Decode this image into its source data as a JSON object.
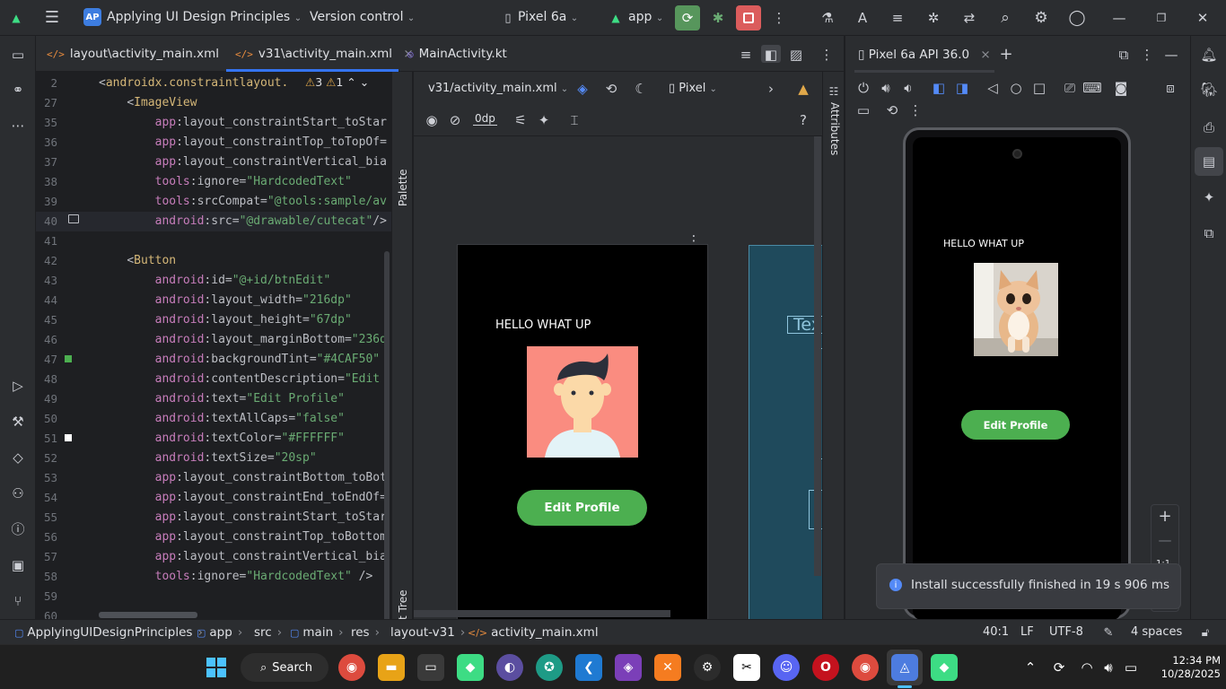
{
  "titlebar": {
    "project_badge": "AP",
    "project_name": "Applying UI Design Principles",
    "vcs": "Version control",
    "device": "Pixel 6a",
    "run_config": "app"
  },
  "tabs": [
    {
      "label": "layout\\activity_main.xml"
    },
    {
      "label": "v31\\activity_main.xml"
    },
    {
      "label": "MainActivity.kt"
    }
  ],
  "editor": {
    "inspection": {
      "warnings": "3",
      "weak": "1"
    },
    "lines": [
      {
        "num": "2",
        "html": "<span class=\"p\">&lt;</span><span class=\"t\">androidx.constraintlayout.</span>"
      },
      {
        "num": "27",
        "html": "    <span class=\"p\">&lt;</span><span class=\"t\">ImageView</span>"
      },
      {
        "num": "35",
        "html": "        <span class=\"a\">app</span><span class=\"n\">:layout_constraintStart_toStar</span>"
      },
      {
        "num": "36",
        "html": "        <span class=\"a\">app</span><span class=\"n\">:layout_constraintTop_toTopOf=</span>"
      },
      {
        "num": "37",
        "html": "        <span class=\"a\">app</span><span class=\"n\">:layout_constraintVertical_bia</span>"
      },
      {
        "num": "38",
        "html": "        <span class=\"a\">tools</span><span class=\"n\">:ignore=</span><span class=\"s\">\"HardcodedText\"</span>"
      },
      {
        "num": "39",
        "html": "        <span class=\"a\">tools</span><span class=\"n\">:srcCompat=</span><span class=\"s\">\"@tools:sample/av</span>"
      },
      {
        "num": "40",
        "html": "        <span class=\"a\">android</span><span class=\"n\">:src=</span><span class=\"s\">\"@drawable/cutecat\"</span><span class=\"p\">/&gt;</span>"
      },
      {
        "num": "41",
        "html": ""
      },
      {
        "num": "42",
        "html": "    <span class=\"p\">&lt;</span><span class=\"t\">Button</span>"
      },
      {
        "num": "43",
        "html": "        <span class=\"a\">android</span><span class=\"n\">:id=</span><span class=\"s\">\"@+id/btnEdit\"</span>"
      },
      {
        "num": "44",
        "html": "        <span class=\"a\">android</span><span class=\"n\">:layout_width=</span><span class=\"s\">\"216dp\"</span>"
      },
      {
        "num": "45",
        "html": "        <span class=\"a\">android</span><span class=\"n\">:layout_height=</span><span class=\"s\">\"67dp\"</span>"
      },
      {
        "num": "46",
        "html": "        <span class=\"a\">android</span><span class=\"n\">:layout_marginBottom=</span><span class=\"s\">\"236d</span>"
      },
      {
        "num": "47",
        "html": "        <span class=\"a\">android</span><span class=\"n\">:backgroundTint=</span><span class=\"s\">\"#4CAF50\"</span>"
      },
      {
        "num": "48",
        "html": "        <span class=\"a\">android</span><span class=\"n\">:contentDescription=</span><span class=\"s\">\"Edit</span>"
      },
      {
        "num": "49",
        "html": "        <span class=\"a\">android</span><span class=\"n\">:text=</span><span class=\"s\">\"Edit Profile\"</span>"
      },
      {
        "num": "50",
        "html": "        <span class=\"a\">android</span><span class=\"n\">:textAllCaps=</span><span class=\"s\">\"false\"</span>"
      },
      {
        "num": "51",
        "html": "        <span class=\"a\">android</span><span class=\"n\">:textColor=</span><span class=\"s\">\"#FFFFFF\"</span>"
      },
      {
        "num": "52",
        "html": "        <span class=\"a\">android</span><span class=\"n\">:textSize=</span><span class=\"s\">\"20sp\"</span>"
      },
      {
        "num": "53",
        "html": "        <span class=\"a\">app</span><span class=\"n\">:layout_constraintBottom_toBot</span>"
      },
      {
        "num": "54",
        "html": "        <span class=\"a\">app</span><span class=\"n\">:layout_constraintEnd_toEndOf=</span>"
      },
      {
        "num": "55",
        "html": "        <span class=\"a\">app</span><span class=\"n\">:layout_constraintStart_toStar</span>"
      },
      {
        "num": "56",
        "html": "        <span class=\"a\">app</span><span class=\"n\">:layout_constraintTop_toBottom</span>"
      },
      {
        "num": "57",
        "html": "        <span class=\"a\">app</span><span class=\"n\">:layout_constraintVertical_bia</span>"
      },
      {
        "num": "58",
        "html": "        <span class=\"a\">tools</span><span class=\"n\">:ignore=</span><span class=\"s\">\"HardcodedText\"</span> <span class=\"p\">/&gt;</span>"
      },
      {
        "num": "59",
        "html": ""
      },
      {
        "num": "60",
        "html": ""
      }
    ]
  },
  "side_panels": {
    "palette": "Palette",
    "component_tree": "Component Tree",
    "attributes": "Attributes"
  },
  "design": {
    "file_dropdown": "v31/activity_main.xml",
    "device_dropdown": "Pixel",
    "margin": "0dp",
    "preview_text": "HELLO WHAT UP",
    "preview_button": "Edit Profile",
    "blueprint_text": "Tex"
  },
  "emulator": {
    "tab": "Pixel 6a API 36.0",
    "screen_text": "HELLO WHAT UP",
    "button": "Edit Profile",
    "zoom_ratio": "1:1",
    "toast": "Install successfully finished in 19 s 906 ms"
  },
  "statusbar": {
    "crumbs": [
      "ApplyingUIDesignPrinciples",
      "app",
      "src",
      "main",
      "res",
      "layout-v31",
      "activity_main.xml"
    ],
    "position": "40:1",
    "line_sep": "LF",
    "encoding": "UTF-8",
    "indent": "4 spaces"
  },
  "taskbar": {
    "search": "Search",
    "time": "12:34 PM",
    "date": "10/28/2025"
  },
  "colors": {
    "accent_green": "#4caf50",
    "selected_tab": "#3574f0",
    "toast_bg": "#393b40"
  }
}
